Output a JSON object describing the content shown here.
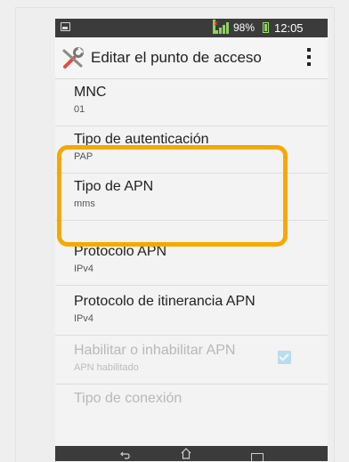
{
  "status_bar": {
    "battery_percent": "98%",
    "time": "12:05"
  },
  "action_bar": {
    "title": "Editar el punto de acceso"
  },
  "settings": [
    {
      "title": "MNC",
      "value": "01"
    },
    {
      "title": "Tipo de autenticación",
      "value": "PAP"
    },
    {
      "title": "Tipo de APN",
      "value": "mms"
    },
    {
      "title": "Protocolo APN",
      "value": "IPv4"
    },
    {
      "title": "Protocolo de itinerancia APN",
      "value": "IPv4"
    },
    {
      "title": "Habilitar o inhabilitar APN",
      "value": "APN habilitado",
      "enabled": false,
      "checked": true
    },
    {
      "title": "Tipo de conexión",
      "value": "",
      "enabled": false
    }
  ],
  "colors": {
    "highlight": "#f4a900",
    "status_bar": "#3b3b3b",
    "signal": "#8ed35f"
  }
}
